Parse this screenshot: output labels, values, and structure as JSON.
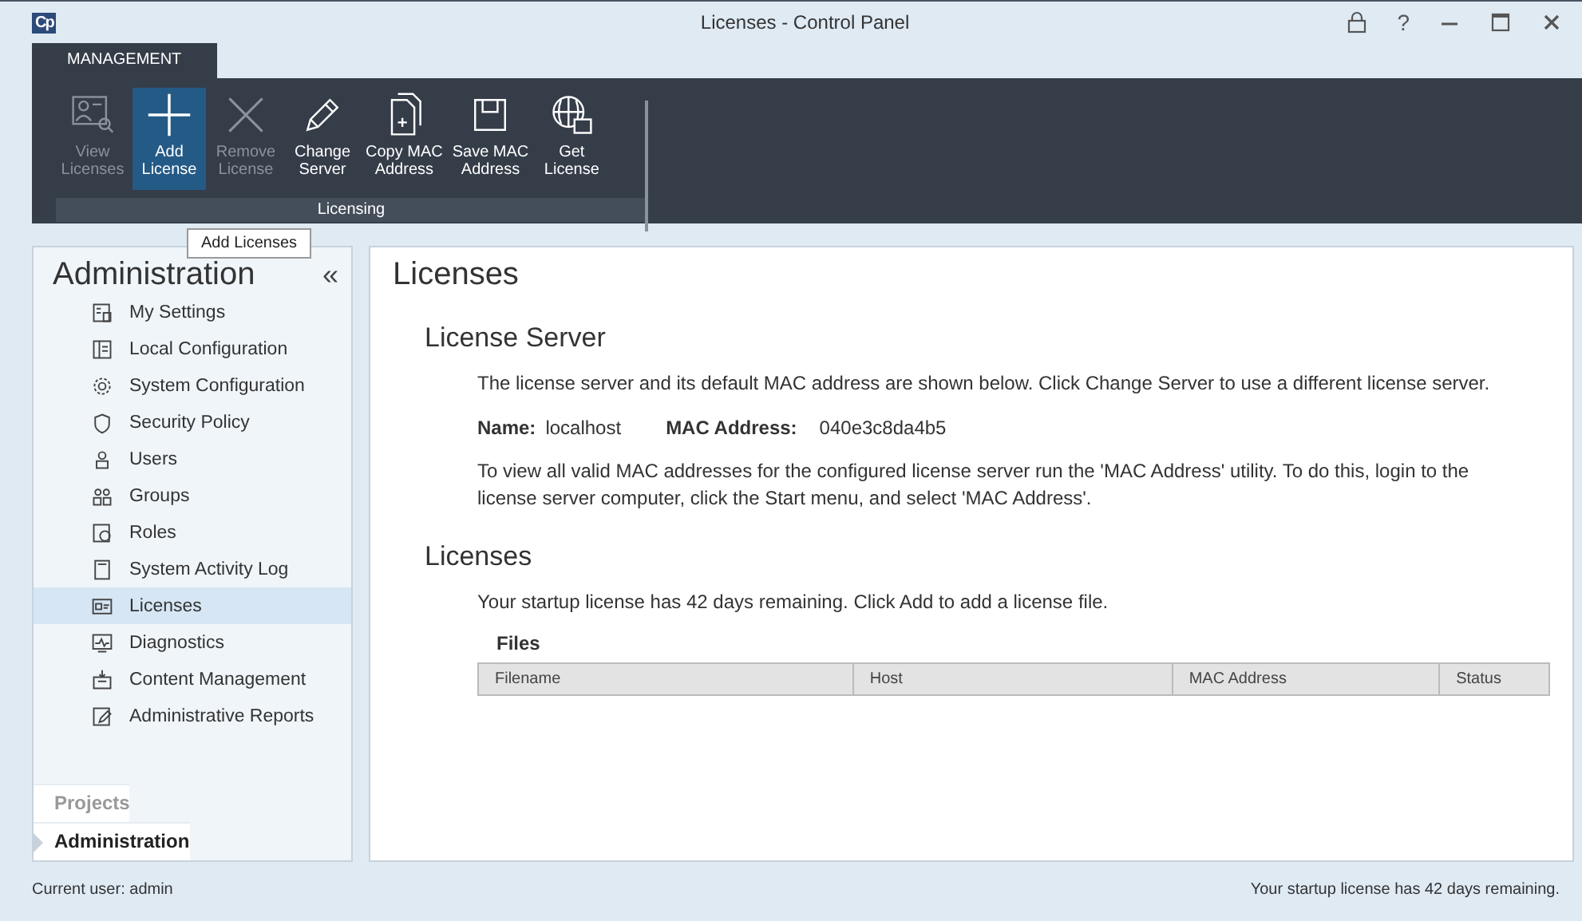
{
  "window": {
    "logo": "Cp",
    "title": "Licenses - Control Panel",
    "controls": [
      "?"
    ]
  },
  "ribbon": {
    "tabs": [
      {
        "label": "MANAGEMENT",
        "selected": true
      }
    ],
    "buttons": [
      {
        "label": "View\nLicenses",
        "disabled": true,
        "selected": false
      },
      {
        "label": "Add\nLicense",
        "disabled": false,
        "selected": true
      },
      {
        "label": "Remove\nLicense",
        "disabled": true,
        "selected": false
      },
      {
        "label": "Change\nServer",
        "disabled": false,
        "selected": false
      },
      {
        "label": "Copy MAC\nAddress",
        "disabled": false,
        "selected": false
      },
      {
        "label": "Save MAC\nAddress",
        "disabled": false,
        "selected": false
      },
      {
        "label": "Get\nLicense",
        "disabled": false,
        "selected": false
      }
    ],
    "group": "Licensing",
    "tooltip": "Add Licenses"
  },
  "sidebar": {
    "title": "Administration",
    "collapse": "«",
    "items": [
      {
        "label": "My Settings",
        "selected": false
      },
      {
        "label": "Local Configuration",
        "selected": false
      },
      {
        "label": "System Configuration",
        "selected": false
      },
      {
        "label": "Security Policy",
        "selected": false
      },
      {
        "label": "Users",
        "selected": false
      },
      {
        "label": "Groups",
        "selected": false
      },
      {
        "label": "Roles",
        "selected": false
      },
      {
        "label": "System Activity Log",
        "selected": false
      },
      {
        "label": "Licenses",
        "selected": true
      },
      {
        "label": "Diagnostics",
        "selected": false
      },
      {
        "label": "Content Management",
        "selected": false
      },
      {
        "label": "Administrative Reports",
        "selected": false
      }
    ],
    "sections": [
      {
        "label": "Projects",
        "selected": false
      },
      {
        "label": "Administration",
        "selected": true
      }
    ]
  },
  "content": {
    "title": "Licenses",
    "server": {
      "heading": "License Server",
      "intro": "The license server and its default MAC address are shown below. Click Change Server to use a different license server.",
      "name_label": "Name:",
      "name": "localhost",
      "mac_label": "MAC Address:",
      "mac": "040e3c8da4b5",
      "note": "To view all valid MAC addresses for the configured license server run the 'MAC Address' utility.  To do this, login to the license server computer, click the Start menu, and select 'MAC Address'."
    },
    "licenses": {
      "heading": "Licenses",
      "text": "Your startup license has 42 days remaining. Click Add to add a license file.",
      "files_label": "Files",
      "table": {
        "columns": [
          "Filename",
          "Host",
          "MAC Address",
          "Status"
        ]
      }
    }
  },
  "status_bar": {
    "user": "Current user: admin",
    "license": "Your startup license has 42 days remaining."
  }
}
